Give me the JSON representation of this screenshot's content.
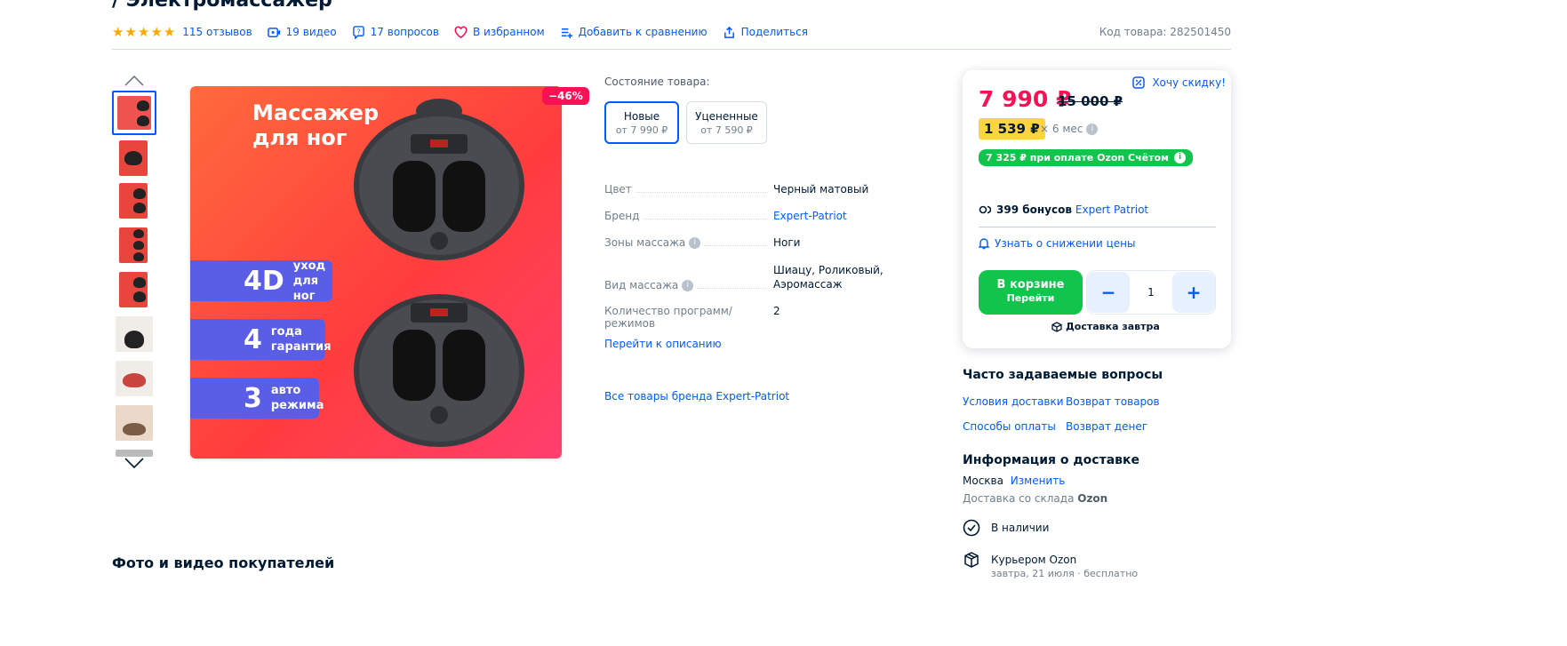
{
  "product": {
    "title": "/ Электромассажер",
    "sku": "Код товара: 282501450"
  },
  "meta": {
    "rating_stars": 5,
    "reviews": "115 отзывов",
    "videos": "19 видео",
    "questions": "17 вопросов",
    "favorite": "В избранном",
    "compare": "Добавить к сравнению",
    "share": "Поделиться"
  },
  "gallery": {
    "discount_badge": "−46%",
    "promo_title_line1": "Массажер",
    "promo_title_line2": "для ног",
    "features": [
      {
        "big": "4D",
        "small": "уход\nдля ног"
      },
      {
        "big": "4",
        "small": "года\nгарантия"
      },
      {
        "big": "3",
        "small": "авто\nрежима"
      }
    ]
  },
  "condition": {
    "label": "Состояние товара:",
    "options": [
      {
        "title": "Новые",
        "price": "от 7 990 ₽"
      },
      {
        "title": "Уцененные",
        "price": "от 7 590 ₽"
      }
    ]
  },
  "specs": [
    {
      "key": "Цвет",
      "value": "Черный матовый",
      "link": false
    },
    {
      "key": "Бренд",
      "value": "Expert-Patriot",
      "link": true
    },
    {
      "key": "Зоны массажа",
      "value": "Ноги",
      "link": false
    },
    {
      "key": "Вид массажа",
      "value": "Шиацу, Роликовый, Аэромассаж",
      "link": false
    },
    {
      "key": "Количество программ/режимов",
      "value": "2",
      "link": false
    }
  ],
  "links": {
    "to_description": "Перейти к описанию",
    "all_brand": "Все товары бренда Expert-Patriot"
  },
  "price_card": {
    "want_discount": "Хочу скидку!",
    "price": "7 990 ₽",
    "old_price": "15 000 ₽",
    "installment": "1 539 ₽",
    "installment_term": "× 6 мес",
    "ozon_card": "7 325 ₽ при оплате Ozon Счётом",
    "bonus_amount": "399 бонусов",
    "bonus_brand": "Expert Patriot",
    "notify": "Узнать о снижении цены",
    "cart_label": "В корзине",
    "cart_sub": "Перейти",
    "quantity": "1",
    "delivery": "Доставка завтра"
  },
  "faq": {
    "title": "Часто задаваемые вопросы",
    "links": [
      "Условия доставки",
      "Возврат товаров",
      "Способы оплаты",
      "Возврат денег"
    ]
  },
  "delivery_info": {
    "title": "Информация о доставке",
    "city": "Москва",
    "change": "Изменить",
    "warehouse_prefix": "Доставка со склада",
    "warehouse_name": "Ozon",
    "stock": "В наличии",
    "courier": "Курьером Ozon",
    "courier_sub": "завтра, 21 июля · бесплатно"
  },
  "photos_title": "Фото и видео покупателей",
  "colors": {
    "accent": "#005bff",
    "price": "#f91155",
    "green": "#10c44c",
    "yellow": "#ffd43f"
  }
}
